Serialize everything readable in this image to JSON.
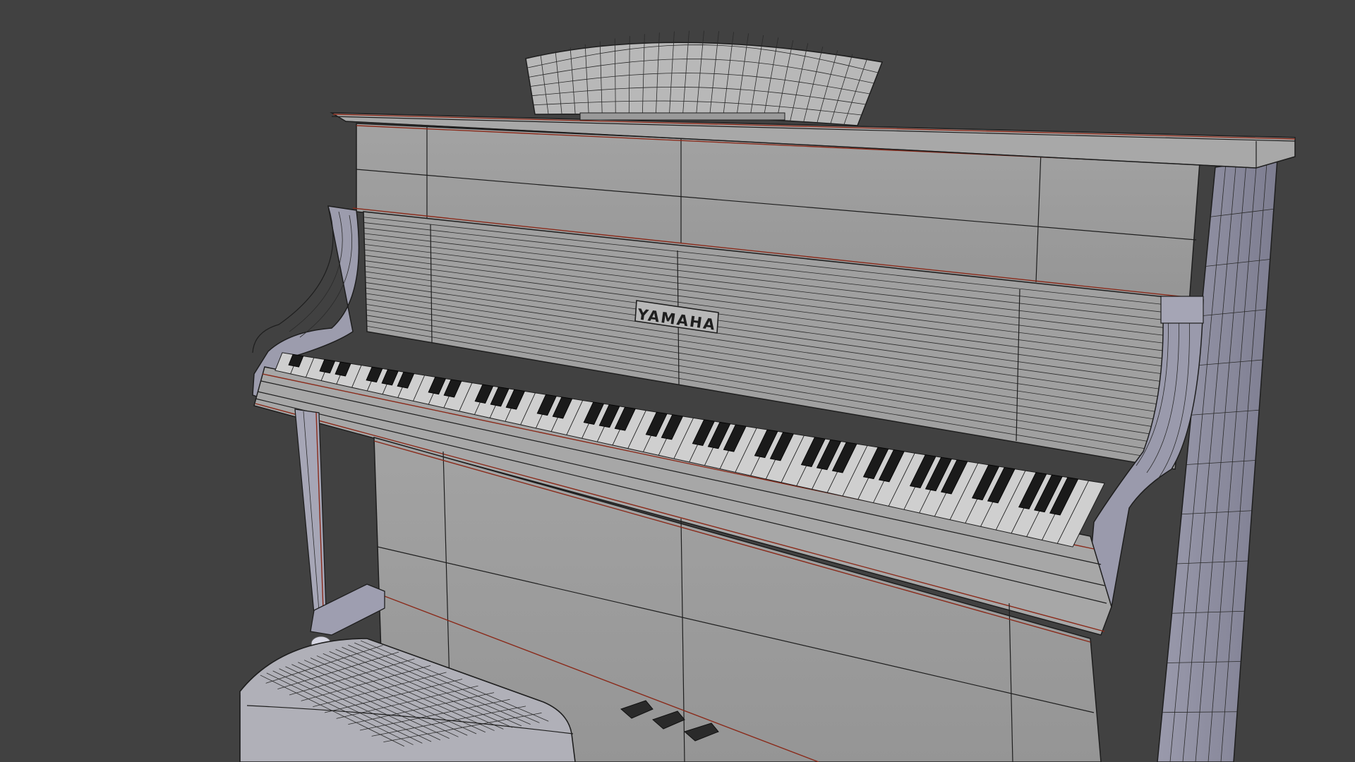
{
  "scene": {
    "subject": "upright-piano-wireframe",
    "background_color": "#414141",
    "surface_color": "#9a9a9a",
    "side_color": "#8c8c9c",
    "wire_color": "#1e1e1e",
    "edge_color": "#8a2a1a"
  },
  "piano": {
    "brand_label": "YAMAHA"
  }
}
